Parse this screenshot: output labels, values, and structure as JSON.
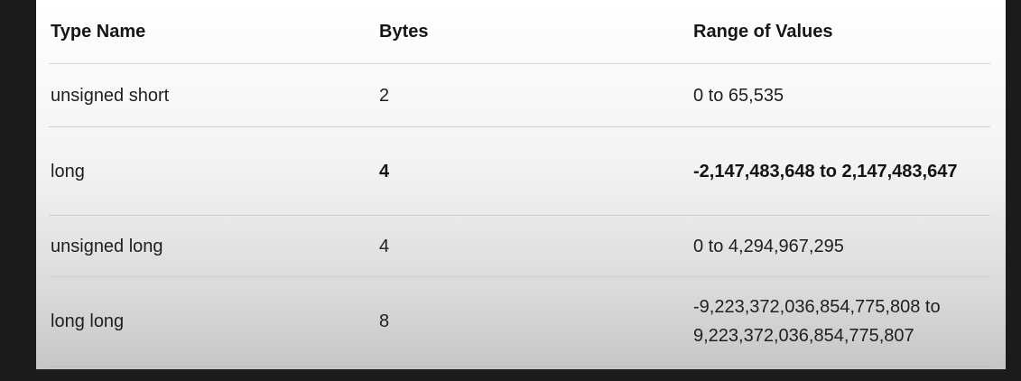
{
  "table": {
    "headers": [
      "Type Name",
      "Bytes",
      "Range of Values"
    ],
    "rows": [
      {
        "type_name": "unsigned short",
        "bytes": "2",
        "range": "0 to 65,535",
        "bold": false
      },
      {
        "type_name": "long",
        "bytes": "4",
        "range": "-2,147,483,648 to 2,147,483,647",
        "bold": true
      },
      {
        "type_name": "unsigned long",
        "bytes": "4",
        "range": "0 to 4,294,967,295",
        "bold": false
      },
      {
        "type_name": "long long",
        "bytes": "8",
        "range": "-9,223,372,036,854,775,808 to 9,223,372,036,854,775,807",
        "bold": false
      }
    ]
  }
}
